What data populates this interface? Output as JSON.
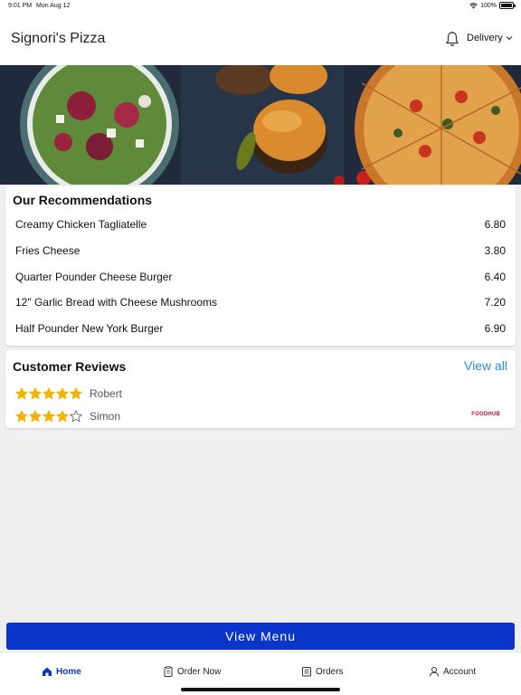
{
  "status_bar": {
    "time": "9:01 PM",
    "date": "Mon Aug 12",
    "battery": "100%",
    "battery_level": 1.0
  },
  "header": {
    "title": "Signori's Pizza",
    "order_mode": "Delivery"
  },
  "recommendations": {
    "title": "Our Recommendations",
    "items": [
      {
        "name": "Creamy Chicken Tagliatelle",
        "price": "6.80"
      },
      {
        "name": "Fries Cheese",
        "price": "3.80"
      },
      {
        "name": "Quarter Pounder Cheese Burger",
        "price": "6.40"
      },
      {
        "name": "12\" Garlic Bread with Cheese Mushrooms",
        "price": "7.20"
      },
      {
        "name": "Half Pounder New York Burger",
        "price": "6.90"
      }
    ]
  },
  "reviews": {
    "title": "Customer Reviews",
    "view_all_label": "View all",
    "items": [
      {
        "name": "Robert",
        "rating": 5,
        "max_rating": 5
      },
      {
        "name": "Simon",
        "rating": 4,
        "max_rating": 5
      }
    ],
    "source_logo": "FOODHUB"
  },
  "view_menu_label": "View Menu",
  "tabs": [
    {
      "label": "Home",
      "icon": "home-icon",
      "active": true
    },
    {
      "label": "Order Now",
      "icon": "clipboard-icon",
      "active": false
    },
    {
      "label": "Orders",
      "icon": "receipt-icon",
      "active": false
    },
    {
      "label": "Account",
      "icon": "user-icon",
      "active": false
    }
  ],
  "colors": {
    "accent": "#0b35c8",
    "link": "#2b8fd1",
    "star": "#f5b301",
    "background": "#efefef"
  }
}
